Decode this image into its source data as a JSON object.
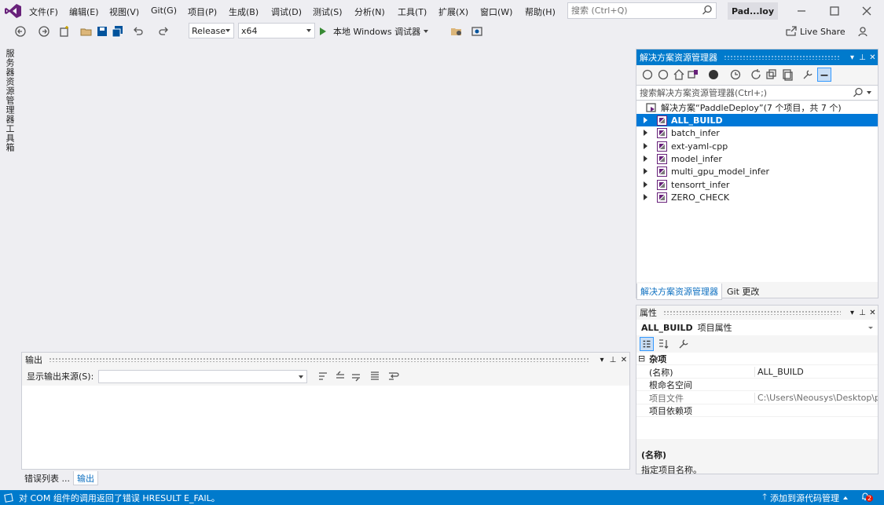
{
  "menu": {
    "items": [
      "文件(F)",
      "编辑(E)",
      "视图(V)",
      "Git(G)",
      "项目(P)",
      "生成(B)",
      "调试(D)",
      "测试(S)",
      "分析(N)",
      "工具(T)",
      "扩展(X)",
      "窗口(W)",
      "帮助(H)"
    ],
    "search_placeholder": "搜索 (Ctrl+Q)",
    "solution_badge": "Pad...loy"
  },
  "toolbar": {
    "config": "Release",
    "platform": "x64",
    "run_label": "本地 Windows 调试器",
    "live_share": "Live Share"
  },
  "left_rail": {
    "tabs": [
      "服务器资源管理器",
      "工具箱"
    ]
  },
  "output": {
    "title": "输出",
    "source_label": "显示输出来源(S):",
    "source_value": ""
  },
  "bottom_tabs": [
    "错误列表 ...",
    "输出"
  ],
  "solution_explorer": {
    "title": "解决方案资源管理器",
    "search_placeholder": "搜索解决方案资源管理器(Ctrl+;)",
    "solution_label": "解决方案“PaddleDeploy”(7 个项目，共 7 个)",
    "projects": [
      "ALL_BUILD",
      "batch_infer",
      "ext-yaml-cpp",
      "model_infer",
      "multi_gpu_model_infer",
      "tensorrt_infer",
      "ZERO_CHECK"
    ],
    "selected": "ALL_BUILD",
    "tabs": [
      "解决方案资源管理器",
      "Git 更改"
    ]
  },
  "properties": {
    "title": "属性",
    "object_name": "ALL_BUILD",
    "object_type": "项目属性",
    "category": "杂项",
    "rows": [
      {
        "key": "(名称)",
        "value": "ALL_BUILD"
      },
      {
        "key": "根命名空间",
        "value": ""
      },
      {
        "key": "项目文件",
        "value": "C:\\Users\\Neousys\\Desktop\\pr\\"
      },
      {
        "key": "项目依赖项",
        "value": ""
      }
    ],
    "desc_title": "(名称)",
    "desc_text": "指定项目名称。"
  },
  "status": {
    "message": "对 COM 组件的调用返回了错误 HRESULT E_FAIL。",
    "source_control": "添加到源代码管理",
    "notifications": "2"
  },
  "colors": {
    "accent": "#007acc",
    "selection": "#0078d7",
    "vs_purple": "#68217a"
  }
}
